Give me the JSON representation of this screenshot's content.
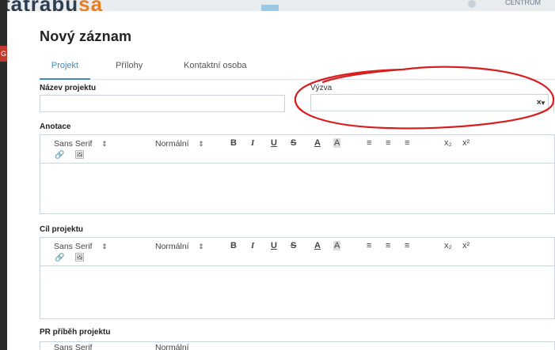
{
  "background": {
    "logo_text": "tatrabu",
    "logo_accent": "sa",
    "user_label": "CENTRUM",
    "side_chip": "G"
  },
  "modal": {
    "title": "Nový záznam",
    "tabs": [
      {
        "label": "Projekt",
        "active": true
      },
      {
        "label": "Přílohy",
        "active": false
      },
      {
        "label": "Kontaktní osoba",
        "active": false
      }
    ],
    "fields": {
      "project_name_label": "Název projektu",
      "project_name_value": "",
      "vyzva_label": "Výzva",
      "vyzva_value": "",
      "vyzva_clear": "×",
      "vyzva_caret": "▼"
    },
    "editors": [
      {
        "label": "Anotace"
      },
      {
        "label": "Cíl projektu"
      },
      {
        "label": "PR příběh projektu"
      }
    ],
    "toolbar": {
      "font": "Sans Serif",
      "size": "Normální",
      "arrows": "⇕",
      "bold": "B",
      "italic": "I",
      "underline": "U",
      "strike": "S",
      "color": "A",
      "background": "A",
      "subscript": "x₂",
      "superscript": "x²"
    }
  },
  "colors": {
    "accent": "#3c8dbc",
    "annotation": "#d81e1e"
  }
}
